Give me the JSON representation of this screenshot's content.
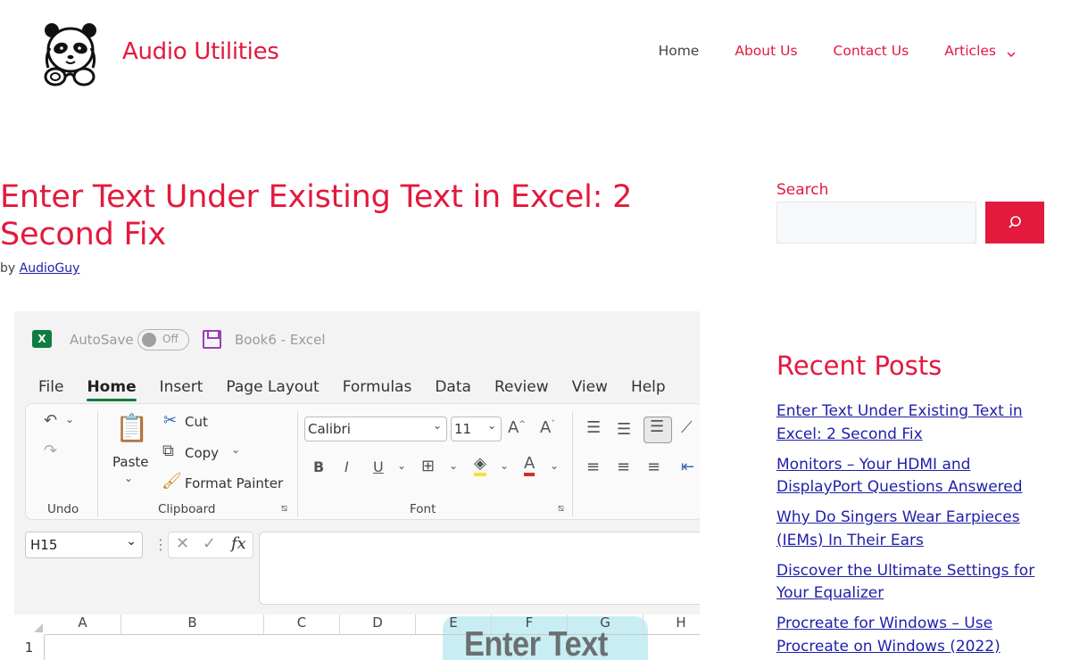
{
  "site": {
    "title": "Audio Utilities",
    "accent_color": "#e3193d",
    "logo_icon": "panda-headphones-logo"
  },
  "nav": {
    "items": [
      {
        "label": "Home"
      },
      {
        "label": "About Us"
      },
      {
        "label": "Contact Us"
      },
      {
        "label": "Articles",
        "has_dropdown": true
      }
    ]
  },
  "article": {
    "title": "Enter Text Under Existing Text in Excel: 2 Second Fix",
    "byline_prefix": "by",
    "author": "AudioGuy"
  },
  "excel": {
    "app_logo": "X",
    "autosave_label": "AutoSave",
    "toggle_label": "Off",
    "book_title": "Book6  -  Excel",
    "tabs": [
      "File",
      "Home",
      "Insert",
      "Page Layout",
      "Formulas",
      "Data",
      "Review",
      "View",
      "Help"
    ],
    "active_tab": "Home",
    "ribbon": {
      "undo_group": "Undo",
      "paste_label": "Paste",
      "cut_label": "Cut",
      "copy_label": "Copy",
      "format_painter_label": "Format Painter",
      "clipboard_group": "Clipboard",
      "font_name": "Calibri",
      "font_size": "11",
      "font_group": "Font"
    },
    "name_box": "H15",
    "fx_label": "fx",
    "columns": [
      "A",
      "B",
      "C",
      "D",
      "E",
      "F",
      "G",
      "H"
    ],
    "row_number": "1",
    "overlay_text": "Enter Text"
  },
  "sidebar": {
    "search_label": "Search",
    "search_placeholder": "",
    "recent_title": "Recent Posts",
    "recent_posts": [
      "Enter Text Under Existing Text in Excel: 2 Second Fix",
      "Monitors – Your HDMI and DisplayPort Questions Answered",
      "Why Do Singers Wear Earpieces (IEMs) In Their Ears",
      "Discover the Ultimate Settings for Your Equalizer",
      "Procreate for Windows – Use Procreate on Windows (2022)"
    ]
  }
}
